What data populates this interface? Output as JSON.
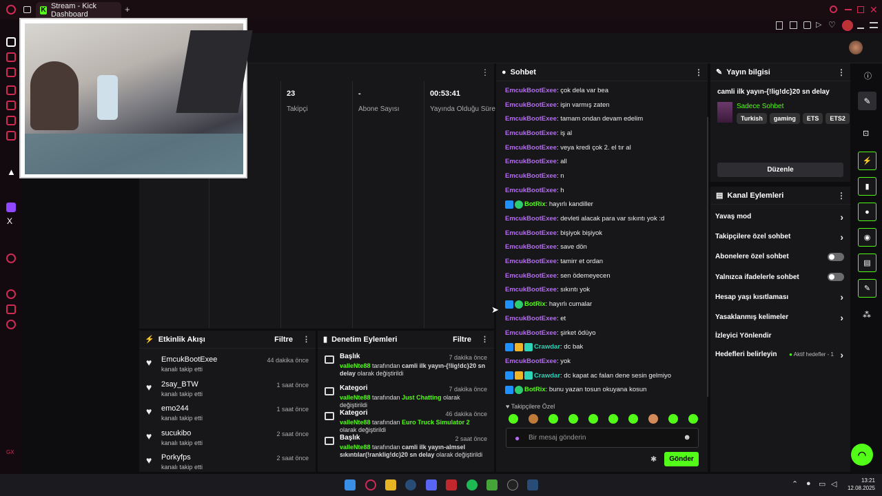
{
  "browser": {
    "tab_title": "Stream - Kick Dashboard",
    "new_tab": "+"
  },
  "main_panel": {
    "stats": [
      {
        "value": "23",
        "label": "Takipçi"
      },
      {
        "value": "-",
        "label": "Abone Sayısı"
      },
      {
        "value": "00:53:41",
        "label": "Yayında Olduğu Süre"
      }
    ]
  },
  "activity": {
    "title": "Etkinlik Akışı",
    "filter": "Filtre",
    "items": [
      {
        "name": "EmcukBootExee",
        "sub": "kanalı takip etti",
        "time": "44 dakika önce"
      },
      {
        "name": "2say_BTW",
        "sub": "kanalı takip etti",
        "time": "1 saat önce"
      },
      {
        "name": "emo244",
        "sub": "kanalı takip etti",
        "time": "1 saat önce"
      },
      {
        "name": "sucukibo",
        "sub": "kanalı takip etti",
        "time": "2 saat önce"
      },
      {
        "name": "Porkyfps",
        "sub": "kanalı takip etti",
        "time": "2 saat önce"
      }
    ]
  },
  "moderation": {
    "title": "Denetim Eylemleri",
    "filter": "Filtre",
    "items": [
      {
        "title": "Başlık",
        "time": "7 dakika önce",
        "user": "valleNte88",
        "mid": " tarafından ",
        "target": "camli ilk yayın-{!lig!dc}20 sn delay",
        "end": " olarak değiştirildi"
      },
      {
        "title": "Kategori",
        "time": "7 dakika önce",
        "user": "valleNte88",
        "mid": " tarafından ",
        "target": "Just Chatting",
        "end": " olarak değiştirildi"
      },
      {
        "title": "Kategori",
        "time": "46 dakika önce",
        "user": "valleNte88",
        "mid": " tarafından ",
        "target": "Euro Truck Simulator 2",
        "end": " olarak değiştirildi"
      },
      {
        "title": "Başlık",
        "time": "2 saat önce",
        "user": "valleNte88",
        "mid": " tarafından ",
        "target": "camli ilk yayın-almsel sıkıntılar(!ranklig!dc)20 sn delay",
        "end": " olarak değiştirildi"
      }
    ]
  },
  "chat": {
    "title": "Sohbet",
    "messages": [
      {
        "user": "EmcukBootExee",
        "type": "user",
        "text": ": çok dela var bea"
      },
      {
        "user": "EmcukBootExee",
        "type": "user",
        "text": ": işin varmış zaten"
      },
      {
        "user": "EmcukBootExee",
        "type": "user",
        "text": ": tamam ondan devam edelim"
      },
      {
        "user": "EmcukBootExee",
        "type": "user",
        "text": ": iş al"
      },
      {
        "user": "EmcukBootExee",
        "type": "user",
        "text": ": veya kredi çok 2. el tır al"
      },
      {
        "user": "EmcukBootExee",
        "type": "user",
        "text": ": all"
      },
      {
        "user": "EmcukBootExee",
        "type": "user",
        "text": ": n"
      },
      {
        "user": "EmcukBootExee",
        "type": "user",
        "text": ": h"
      },
      {
        "user": "BotRix",
        "type": "bot",
        "text": ": hayırlı kandiller"
      },
      {
        "user": "EmcukBootExee",
        "type": "user",
        "text": ": devleti alacak para var sıkıntı yok :d"
      },
      {
        "user": "EmcukBootExee",
        "type": "user",
        "text": ": bişiyok bişiyok"
      },
      {
        "user": "EmcukBootExee",
        "type": "user",
        "text": ": save dön"
      },
      {
        "user": "EmcukBootExee",
        "type": "user",
        "text": ": tamirr et ordan"
      },
      {
        "user": "EmcukBootExee",
        "type": "user",
        "text": ": sen ödemeyecen"
      },
      {
        "user": "EmcukBootExee",
        "type": "user",
        "text": ": sıkıntı yok"
      },
      {
        "user": "BotRix",
        "type": "bot",
        "text": ": hayırlı cumalar"
      },
      {
        "user": "EmcukBootExee",
        "type": "user",
        "text": ": et"
      },
      {
        "user": "EmcukBootExee",
        "type": "user",
        "text": ": şirket ödüyo"
      },
      {
        "user": "Crawdar",
        "type": "mod",
        "text": ": dc bak"
      },
      {
        "user": "EmcukBootExee",
        "type": "user",
        "text": ": yok"
      },
      {
        "user": "Crawdar",
        "type": "mod",
        "text": ": dc kapat ac falan dene sesin gelmiyo"
      },
      {
        "user": "BotRix",
        "type": "bot",
        "text": ": bunu yazan tosun okuyana kosun"
      }
    ],
    "followers_only": "Takipçilere Özel",
    "input_placeholder": "Bir mesaj gönderin",
    "send": "Gönder"
  },
  "stream_info": {
    "title": "Yayın bilgisi",
    "stream_title": "camli ilk yayın-{!lig!dc}20 sn delay",
    "category": "Sadece Sohbet",
    "tags": [
      "Turkish",
      "gaming",
      "ETS",
      "ETS2"
    ],
    "edit": "Düzenle"
  },
  "channel_actions": {
    "title": "Kanal Eylemleri",
    "items": [
      {
        "label": "Yavaş mod",
        "control": "chevron"
      },
      {
        "label": "Takipçilere özel sohbet",
        "control": "chevron"
      },
      {
        "label": "Abonelere özel sohbet",
        "control": "toggle"
      },
      {
        "label": "Yalnızca ifadelerle sohbet",
        "control": "toggle"
      },
      {
        "label": "Hesap yaşı kısıtlaması",
        "control": "chevron"
      },
      {
        "label": "Yasaklanmış kelimeler",
        "control": "chevron"
      },
      {
        "label": "İzleyici Yönlendir",
        "control": "none"
      },
      {
        "label": "Hedefleri belirleyin",
        "control": "goals",
        "extra": "Aktif hedefler - 1"
      }
    ]
  },
  "taskbar": {
    "time": "13:21",
    "date": "12.08.2025"
  },
  "colors": {
    "accent": "#53fc18",
    "opera": "#d22a55",
    "username": "#b46cf0"
  }
}
